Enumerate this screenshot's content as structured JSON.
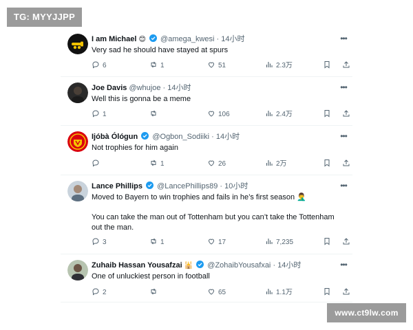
{
  "watermarks": {
    "top": "TG: MYYJJPP",
    "bottom": "www.ct9lw.com"
  },
  "tweets": [
    {
      "name": "I am Michael",
      "name_suffix": "😊",
      "verified": true,
      "handle": "@amega_kwesi",
      "dot": "·",
      "time": "14小时",
      "text": [
        "Very sad he should have stayed at spurs"
      ],
      "replies": "6",
      "retweets": "1",
      "likes": "51",
      "views": "2.3万",
      "avatar": "arsenal-cannon-avatar"
    },
    {
      "name": "Joe Davis",
      "name_suffix": "",
      "verified": false,
      "handle": "@whujoe",
      "dot": "·",
      "time": "14小时",
      "text": [
        "Well this is gonna be a meme"
      ],
      "replies": "1",
      "retweets": "",
      "likes": "106",
      "views": "2.4万",
      "avatar": "dark-portrait-avatar"
    },
    {
      "name": "Ijóbà Ólógun",
      "name_suffix": "",
      "verified": true,
      "handle": "@Ogbon_Sodiiki",
      "dot": "·",
      "time": "14小时",
      "text": [
        "Not trophies for him again"
      ],
      "replies": "",
      "retweets": "1",
      "likes": "26",
      "views": "2万",
      "avatar": "manchester-united-crest-avatar"
    },
    {
      "name": "Lance Phillips",
      "name_suffix": "",
      "verified": true,
      "handle": "@LancePhillips89",
      "dot": "·",
      "time": "10小时",
      "text": [
        "Moved to Bayern to win trophies and fails in he’s first season 🤦‍♂️",
        "",
        "You can take the man out of Tottenham but you can’t take the Tottenham",
        "out the man."
      ],
      "replies": "3",
      "retweets": "1",
      "likes": "17",
      "views": "7,235",
      "avatar": "light-portrait-avatar"
    },
    {
      "name": "Zuhaib Hassan Yousafzai",
      "name_suffix": "🕌",
      "verified": true,
      "handle": "@ZohaibYousafxai",
      "dot": "·",
      "time": "14小时",
      "text": [
        "One of unluckiest person in football"
      ],
      "replies": "2",
      "retweets": "",
      "likes": "65",
      "views": "1.1万",
      "avatar": "outdoor-portrait-avatar"
    }
  ],
  "colors": {
    "verified": "#1d9bf0",
    "muted": "#536471",
    "text": "#0f1419",
    "divider": "#eff3f4"
  }
}
